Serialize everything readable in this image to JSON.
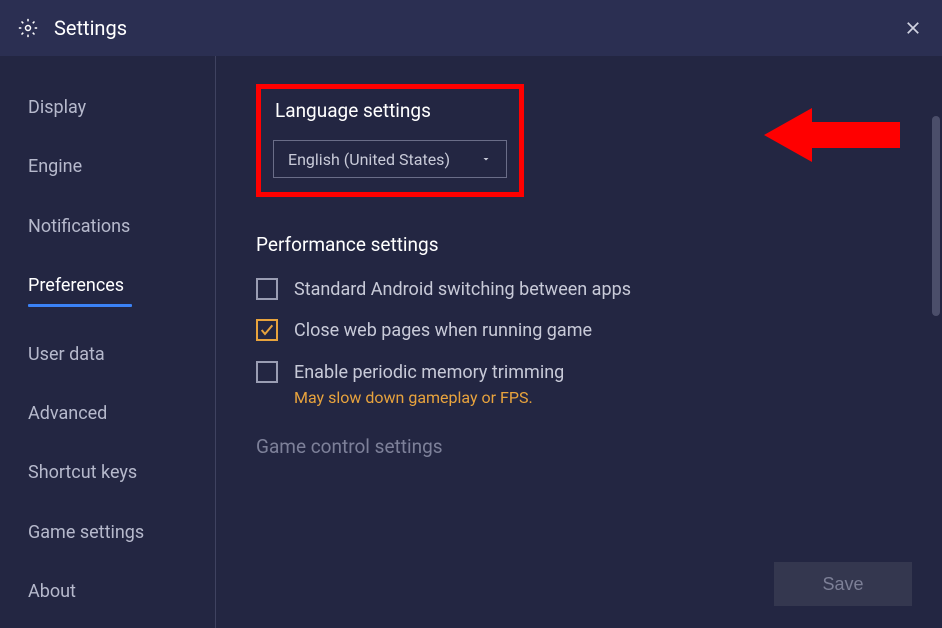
{
  "titlebar": {
    "title": "Settings"
  },
  "sidebar": {
    "items": [
      {
        "label": "Display",
        "active": false
      },
      {
        "label": "Engine",
        "active": false
      },
      {
        "label": "Notifications",
        "active": false
      },
      {
        "label": "Preferences",
        "active": true
      },
      {
        "label": "User data",
        "active": false
      },
      {
        "label": "Advanced",
        "active": false
      },
      {
        "label": "Shortcut keys",
        "active": false
      },
      {
        "label": "Game settings",
        "active": false
      },
      {
        "label": "About",
        "active": false
      }
    ]
  },
  "content": {
    "language": {
      "title": "Language settings",
      "selected": "English (United States)"
    },
    "performance": {
      "title": "Performance settings",
      "options": [
        {
          "label": "Standard Android switching between apps",
          "checked": false,
          "note": ""
        },
        {
          "label": "Close web pages when running game",
          "checked": true,
          "note": ""
        },
        {
          "label": "Enable periodic memory trimming",
          "checked": false,
          "note": "May slow down gameplay or FPS."
        }
      ]
    },
    "game_control": {
      "title": "Game control settings"
    }
  },
  "footer": {
    "save": "Save"
  }
}
